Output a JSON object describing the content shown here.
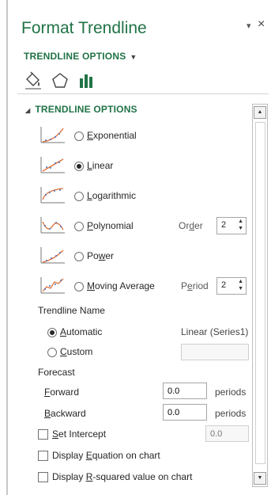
{
  "panel": {
    "title": "Format Trendline",
    "pin_glyph": "▾",
    "close_glyph": "×",
    "options_dropdown": "TRENDLINE OPTIONS",
    "tabs": [
      "fill-line-icon",
      "effects-icon",
      "trendline-options-icon"
    ],
    "active_tab": 2
  },
  "section": {
    "title": "TRENDLINE OPTIONS"
  },
  "types": [
    {
      "pre": "",
      "key": "E",
      "post": "xponential",
      "selected": false
    },
    {
      "pre": "",
      "key": "L",
      "post": "inear",
      "selected": true
    },
    {
      "pre": "",
      "key": "L",
      "post": "ogarithmic",
      "selected": false
    },
    {
      "pre": "",
      "key": "P",
      "post": "olynomial",
      "selected": false
    },
    {
      "pre": "Po",
      "key": "w",
      "post": "er",
      "selected": false
    },
    {
      "pre": "",
      "key": "M",
      "post": "oving Average",
      "selected": false
    }
  ],
  "order": {
    "pre": "Or",
    "key": "d",
    "post": "er",
    "value": "2"
  },
  "period": {
    "pre": "P",
    "key": "e",
    "post": "riod",
    "value": "2"
  },
  "trendline_name": {
    "heading": "Trendline Name",
    "automatic": {
      "key": "A",
      "post": "utomatic",
      "selected": true
    },
    "automatic_value": "Linear (Series1)",
    "custom": {
      "key": "C",
      "post": "ustom",
      "selected": false
    },
    "custom_value": ""
  },
  "forecast": {
    "heading": "Forecast",
    "forward": {
      "key": "F",
      "post": "orward",
      "value": "0.0",
      "unit": "periods"
    },
    "backward": {
      "key": "B",
      "post": "ackward",
      "value": "0.0",
      "unit": "periods"
    }
  },
  "checks": {
    "intercept": {
      "key": "S",
      "post": "et Intercept",
      "value": "0.0",
      "checked": false
    },
    "equation": {
      "pre": "Display ",
      "key": "E",
      "post": "quation on chart",
      "checked": false
    },
    "rsquared": {
      "pre": "Display ",
      "key": "R",
      "post": "-squared value on chart",
      "checked": false
    }
  },
  "colors": {
    "accent": "#217346",
    "trend": "#e0703a",
    "points": "#4472c4"
  }
}
